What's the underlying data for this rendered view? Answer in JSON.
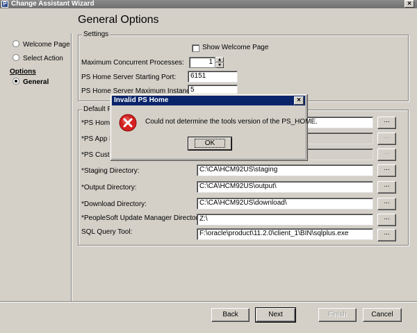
{
  "window": {
    "title": "Change Assistant Wizard",
    "app_icon": "P",
    "close_glyph": "×"
  },
  "heading": "General Options",
  "nav": {
    "welcome": "Welcome Page",
    "select_action": "Select Action",
    "section": "Options",
    "general": "General"
  },
  "settings": {
    "legend": "Settings",
    "show_welcome_label": "Show Welcome Page",
    "max_concurrent_label": "Maximum Concurrent Processes:",
    "max_concurrent_value": "1",
    "start_port_label": "PS Home Server Starting Port:",
    "start_port_value": "6151",
    "max_instances_label": "PS Home Server Maximum Instances:",
    "max_instances_value": "5"
  },
  "default_paths": {
    "legend": "Default P",
    "browse_label": "...",
    "ps_home_label": "*PS Home",
    "ps_app_label": "*PS App H",
    "ps_cust_label": "*PS Cust H",
    "staging_label": "*Staging Directory:",
    "staging_value": "C:\\CA\\HCM92US\\staging",
    "output_label": "*Output Directory:",
    "output_value": "C:\\CA\\HCM92US\\output\\",
    "download_label": "*Download Directory:",
    "download_value": "C:\\CA\\HCM92US\\download\\",
    "pum_label": "*PeopleSoft Update Manager Directory:",
    "pum_value": "Z:\\",
    "sql_label": "SQL Query Tool:",
    "sql_value": "F:\\oracle\\product\\11.2.0\\client_1\\BIN\\sqlplus.exe"
  },
  "buttons": {
    "back": "Back",
    "next": "Next",
    "finish": "Finish",
    "cancel": "Cancel"
  },
  "dialog": {
    "title": "Invalid PS Home",
    "message": "Could not determine the tools version of the PS_HOME.",
    "ok": "OK",
    "close_glyph": "×",
    "icon": "error-icon"
  },
  "colors": {
    "dialog_title_bg": "#0a246a",
    "error_red": "#d42020",
    "window_bg": "#d4d0c8"
  }
}
